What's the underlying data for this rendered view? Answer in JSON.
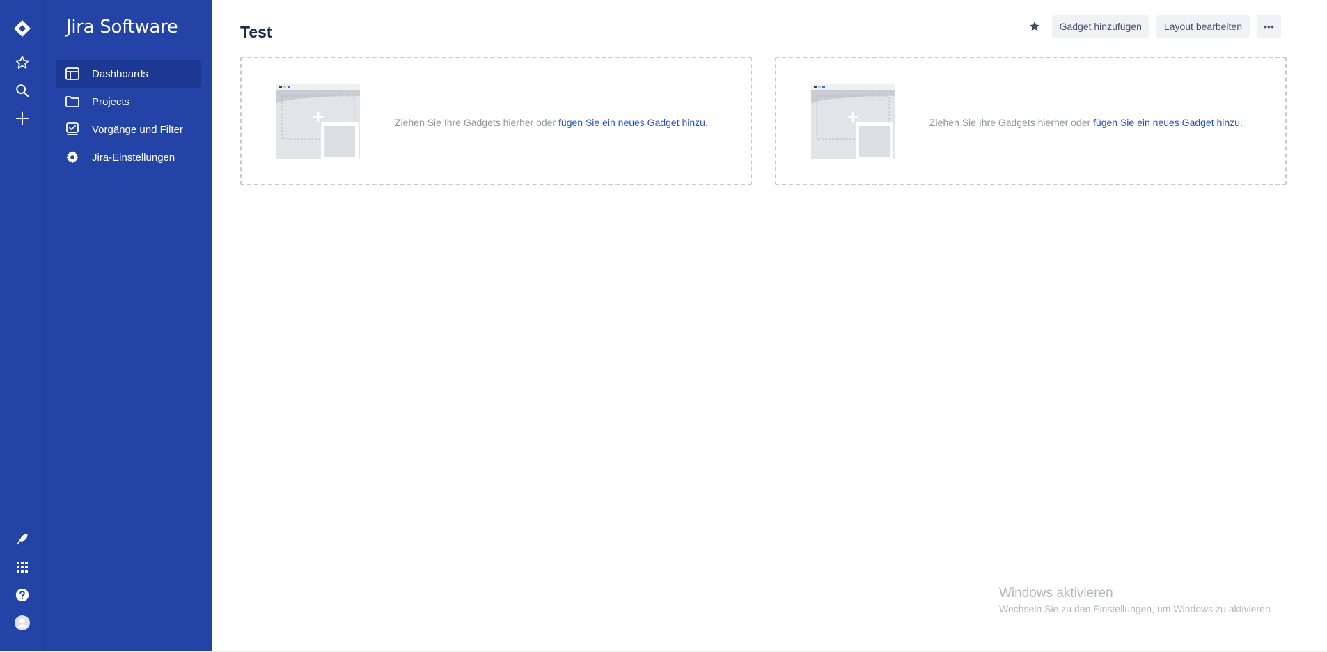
{
  "app": {
    "title": "Jira Software"
  },
  "rail": {
    "logo_icon": "jira-logo-icon",
    "top_icons": [
      "star-icon",
      "search-icon",
      "plus-icon"
    ],
    "bottom_icons": [
      "rocket-icon",
      "app-grid-icon",
      "help-icon",
      "user-avatar-icon"
    ]
  },
  "sidebar": {
    "items": [
      {
        "label": "Dashboards",
        "icon": "dashboard-icon",
        "active": true
      },
      {
        "label": "Projects",
        "icon": "folder-icon",
        "active": false
      },
      {
        "label": "Vorgänge und Filter",
        "icon": "issues-filter-icon",
        "active": false
      },
      {
        "label": "Jira-Einstellungen",
        "icon": "gear-icon",
        "active": false
      }
    ]
  },
  "dashboard": {
    "title": "Test",
    "toolbar": {
      "star_icon": "star-icon",
      "add_gadget_label": "Gadget hinzufügen",
      "edit_layout_label": "Layout bearbeiten",
      "more_label": "•••"
    },
    "columns": [
      {
        "empty_text": "Ziehen Sie Ihre Gadgets hierher oder ",
        "link_text": "fügen Sie ein neues Gadget hinzu."
      },
      {
        "empty_text": "Ziehen Sie Ihre Gadgets hierher oder ",
        "link_text": "fügen Sie ein neues Gadget hinzu."
      }
    ]
  },
  "watermark": {
    "title": "Windows aktivieren",
    "subtitle": "Wechseln Sie zu den Einstellungen, um Windows zu aktivieren."
  },
  "colors": {
    "sidebar": "#2343a6",
    "active_item": "#1d3893",
    "link": "#2454c4"
  }
}
